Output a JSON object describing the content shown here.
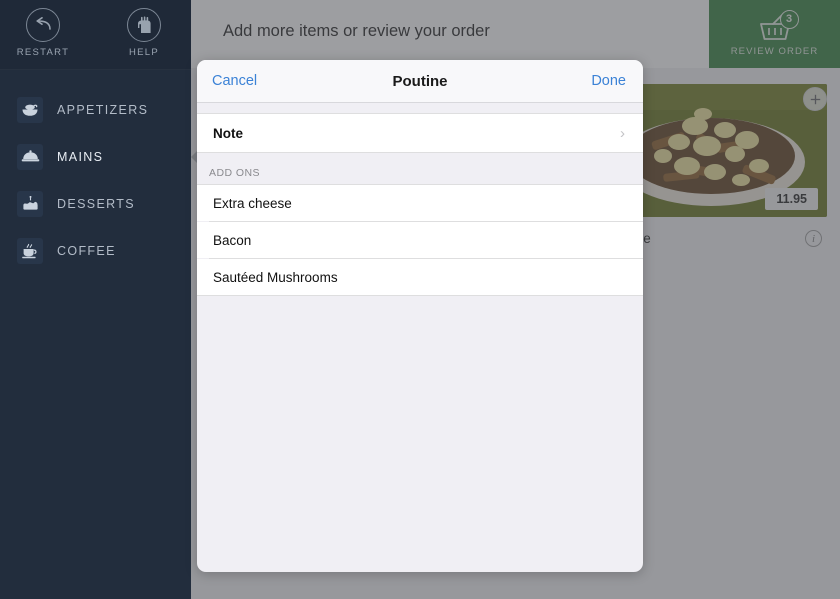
{
  "sidebar": {
    "top_actions": [
      {
        "id": "restart",
        "label": "RESTART",
        "icon": "back-arrow-icon"
      },
      {
        "id": "help",
        "label": "HELP",
        "icon": "raised-hand-icon"
      }
    ],
    "items": [
      {
        "label": "APPETIZERS",
        "icon": "soup-bowl-icon",
        "active": false
      },
      {
        "label": "MAINS",
        "icon": "food-cloche-icon",
        "active": true
      },
      {
        "label": "DESSERTS",
        "icon": "cake-icon",
        "active": false
      },
      {
        "label": "COFFEE",
        "icon": "coffee-cup-icon",
        "active": false
      }
    ]
  },
  "header": {
    "title": "Add more items or review your order",
    "review_order": {
      "label": "REVIEW ORDER",
      "badge_count": "3",
      "icon": "shopping-basket-icon",
      "color": "#2e7d3a"
    }
  },
  "product": {
    "name": "Poutine",
    "price": "11.95",
    "add_icon": "plus-icon",
    "info_icon": "info-icon"
  },
  "modal": {
    "cancel_label": "Cancel",
    "title": "Poutine",
    "done_label": "Done",
    "accent_color": "#3b82d6",
    "note_row": {
      "label": "Note",
      "chevron": "chevron-right-icon"
    },
    "addons_section_title": "ADD ONS",
    "addons": [
      {
        "label": "Extra cheese"
      },
      {
        "label": "Bacon"
      },
      {
        "label": "Sautéed Mushrooms"
      }
    ]
  },
  "colors": {
    "sidebar_bg": "#222d3d",
    "overlay": "#85878b",
    "modal_bg": "#f0eff4"
  }
}
